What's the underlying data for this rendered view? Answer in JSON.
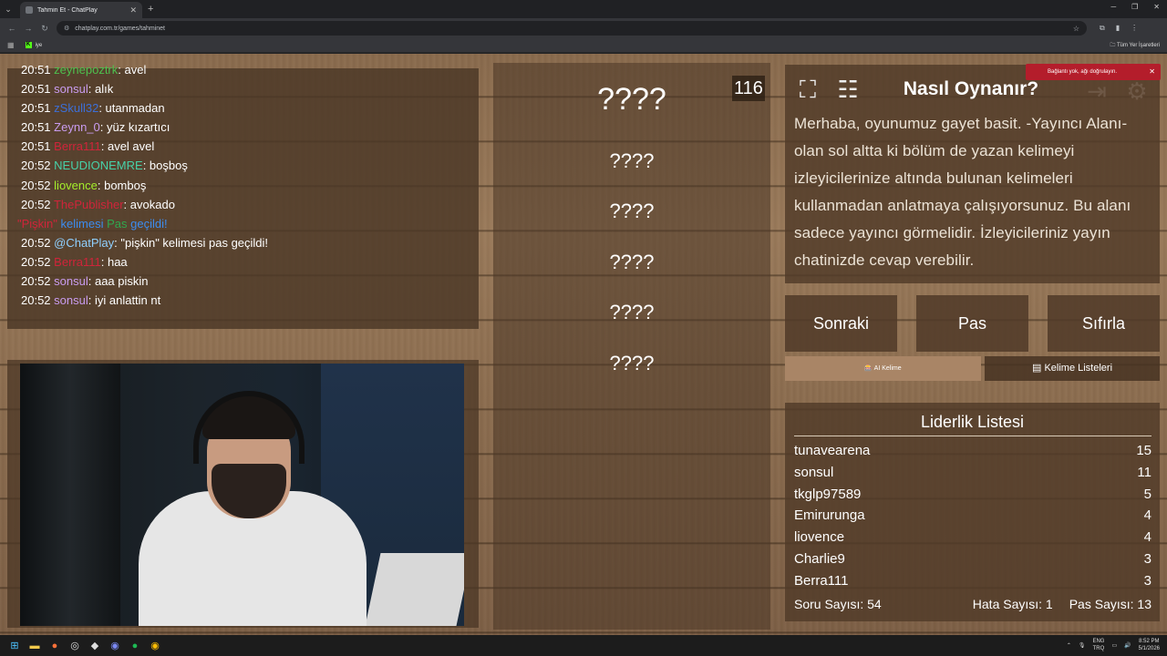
{
  "browser": {
    "tab_title": "Tahmin Et - ChatPlay",
    "url": "chatplay.com.tr/games/tahminet",
    "bookmark": "iye",
    "all_bookmarks": "Tüm Yer İşaretleri"
  },
  "chat": {
    "messages": [
      {
        "time": "20:51",
        "user": "zeynepoztrk",
        "color": "#4ec04e",
        "text": ": avel"
      },
      {
        "time": "20:51",
        "user": "sonsul",
        "color": "#c99cf0",
        "text": ": alık"
      },
      {
        "time": "20:51",
        "user": "zSkull32",
        "color": "#3c6fd8",
        "text": ": utanmadan"
      },
      {
        "time": "20:51",
        "user": "Zeynn_0",
        "color": "#c99cf0",
        "text": ": yüz kızartıcı"
      },
      {
        "time": "20:51",
        "user": "Berra111",
        "color": "#d0243a",
        "text": ": avel avel"
      },
      {
        "time": "20:52",
        "user": "NEUDIONEMRE",
        "color": "#47d1a8",
        "text": ": boşboş"
      },
      {
        "time": "20:52",
        "user": "liovence",
        "color": "#a4ee2c",
        "text": ": bomboş"
      },
      {
        "time": "20:52",
        "user": "ThePublisher",
        "color": "#d0243a",
        "text": ": avokado"
      },
      {
        "time": "20:52",
        "user": "@ChatPlay",
        "color": "#8fd0ff",
        "text": ": \"pişkin\" kelimesi pas geçildi!"
      },
      {
        "time": "20:52",
        "user": "Berra111",
        "color": "#d0243a",
        "text": ": haa"
      },
      {
        "time": "20:52",
        "user": "sonsul",
        "color": "#c99cf0",
        "text": ": aaa piskin"
      },
      {
        "time": "20:52",
        "user": "sonsul",
        "color": "#c99cf0",
        "text": ": iyi anlattin nt"
      }
    ],
    "system": {
      "word": "\"Pişkin\"",
      "middle": "kelimesi",
      "pas": "Pas",
      "end": "geçildi!"
    }
  },
  "game": {
    "counter": "116",
    "current_word": "????",
    "words": [
      "????",
      "????",
      "????",
      "????",
      "????"
    ]
  },
  "howto": {
    "title": "Nasıl Oynanır?",
    "text": "Merhaba, oyunumuz gayet basit. -Yayıncı Alanı- olan sol altta ki bölüm de yazan kelimeyi izleyicilerinize altında bulunan kelimeleri kullanmadan anlatmaya çalışıyorsunuz. Bu alanı sadece yayıncı görmelidir. İzleyicileriniz yayın chatinizde cevap verebilir."
  },
  "notice": "Bağlantı yok, ağı doğrulayın.",
  "buttons": {
    "next": "Sonraki",
    "pas": "Pas",
    "reset": "Sıfırla"
  },
  "tabs": {
    "ai": "🎰 AI Kelime",
    "lists": "Kelime Listeleri"
  },
  "leaderboard": {
    "title": "Liderlik Listesi",
    "rows": [
      {
        "name": "tunavearena",
        "score": "15"
      },
      {
        "name": "sonsul",
        "score": "11"
      },
      {
        "name": "tkglp97589",
        "score": "5"
      },
      {
        "name": "Emirurunga",
        "score": "4"
      },
      {
        "name": "liovence",
        "score": "4"
      },
      {
        "name": "Charlie9",
        "score": "3"
      },
      {
        "name": "Berra111",
        "score": "3"
      }
    ],
    "stats": {
      "questions": "Soru Sayısı: 54",
      "errors": "Hata Sayısı: 1",
      "passes": "Pas Sayısı: 13"
    }
  },
  "taskbar": {
    "lang_top": "ENG",
    "lang_bottom": "TRQ",
    "time": "8:52 PM",
    "date": "5/1/2026"
  }
}
